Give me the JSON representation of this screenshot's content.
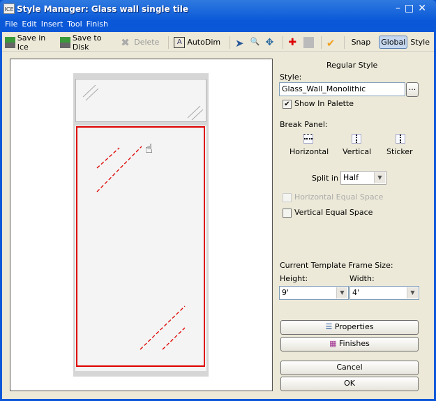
{
  "window": {
    "title": "Style Manager: Glass wall single tile",
    "app_icon": "ICE"
  },
  "menu": [
    "File",
    "Edit",
    "Insert",
    "Tool",
    "Finish"
  ],
  "toolbar": {
    "save_ice": "Save in Ice",
    "save_disk": "Save to Disk",
    "delete": "Delete",
    "autodim": "AutoDim",
    "snap": "Snap",
    "global": "Global",
    "style": "Style"
  },
  "panel": {
    "heading": "Regular Style",
    "style_label": "Style:",
    "style_value": "Glass_Wall_Monolithic",
    "browse": "...",
    "show_in_palette": "Show In Palette",
    "show_in_palette_checked": true,
    "break_panel": "Break Panel:",
    "horizontal": "Horizontal",
    "vertical": "Vertical",
    "sticker": "Sticker",
    "split_in": "Split in",
    "split_value": "Half",
    "h_equal": "Horizontal Equal Space",
    "v_equal": "Vertical Equal Space",
    "frame_size": "Current Template Frame Size:",
    "height_label": "Height:",
    "height_value": "9'",
    "width_label": "Width:",
    "width_value": "4'",
    "properties": "Properties",
    "finishes": "Finishes",
    "cancel": "Cancel",
    "ok": "OK"
  },
  "colors": {
    "selection": "#e00000",
    "titlebar": "#0a58d8"
  }
}
